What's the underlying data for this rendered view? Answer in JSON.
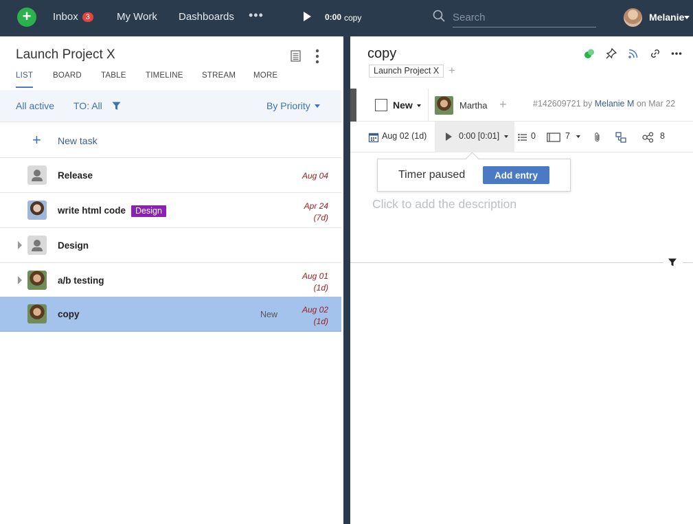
{
  "topbar": {
    "inbox_label": "Inbox",
    "inbox_count": "3",
    "mywork_label": "My Work",
    "dashboards_label": "Dashboards",
    "more_label": "•••",
    "timer_value": "0:00",
    "timer_task": "copy",
    "search_placeholder": "Search",
    "user_name": "Melanie"
  },
  "left": {
    "project_title": "Launch Project X",
    "tabs": [
      "LIST",
      "BOARD",
      "TABLE",
      "TIMELINE",
      "STREAM",
      "MORE"
    ],
    "active_tab": "LIST",
    "filter": {
      "all_active": "All active",
      "to_all": "TO: All",
      "sort": "By Priority"
    },
    "new_task_label": "New task",
    "tasks": [
      {
        "title": "Release",
        "date": "Aug 04",
        "duration": "",
        "tag": "",
        "status": "",
        "avatar": "placeholder",
        "expandable": false
      },
      {
        "title": "write html code",
        "date": "Apr 24",
        "duration": "(7d)",
        "tag": "Design",
        "status": "",
        "avatar": "photo",
        "expandable": false
      },
      {
        "title": "Design",
        "date": "",
        "duration": "",
        "tag": "",
        "status": "",
        "avatar": "placeholder",
        "expandable": true
      },
      {
        "title": "a/b testing",
        "date": "Aug 01",
        "duration": "(1d)",
        "tag": "",
        "status": "",
        "avatar": "photo",
        "expandable": true
      },
      {
        "title": "copy",
        "date": "Aug 02",
        "duration": "(1d)",
        "tag": "",
        "status": "New",
        "avatar": "photo",
        "expandable": false,
        "selected": true
      }
    ]
  },
  "right": {
    "task_title": "copy",
    "project_chip": "Launch Project X",
    "status": "New",
    "assignee": "Martha",
    "meta_id": "#142609721",
    "meta_by": "by",
    "meta_author": "Melanie M",
    "meta_on": "on Mar 22",
    "due_date": "Aug 02 (1d)",
    "timer": "0:00 [0:01]",
    "subtasks_count": "0",
    "attachments_count": "7",
    "followers_count": "8",
    "popover": {
      "label": "Timer paused",
      "button": "Add entry"
    },
    "description_placeholder": "Click to add the description"
  },
  "colors": {
    "topbar_bg": "#2b3b4e",
    "accent_blue": "#4a7ac4",
    "add_green": "#2bb24c",
    "badge_red": "#e2463f",
    "design_tag": "#8b1fb8",
    "selected_row": "#a3c2ec",
    "due_date_red": "#9e1b1b"
  }
}
